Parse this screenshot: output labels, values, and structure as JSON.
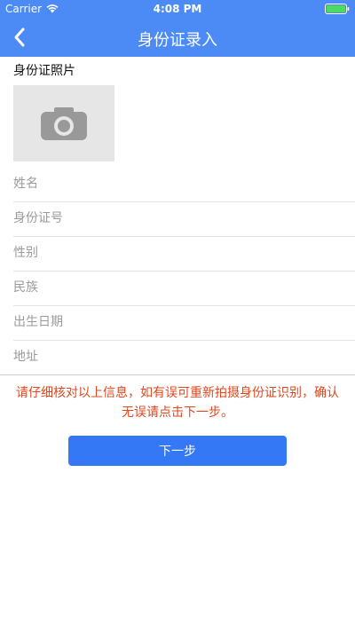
{
  "status_bar": {
    "carrier": "Carrier",
    "time": "4:08 PM",
    "battery_color": "#4cd964"
  },
  "nav": {
    "title": "身份证录入",
    "back_icon": "chevron-left-icon"
  },
  "photo_section": {
    "label": "身份证照片",
    "icon": "camera-icon"
  },
  "fields": [
    {
      "placeholder": "姓名",
      "value": ""
    },
    {
      "placeholder": "身份证号",
      "value": ""
    },
    {
      "placeholder": "性别",
      "value": ""
    },
    {
      "placeholder": "民族",
      "value": ""
    },
    {
      "placeholder": "出生日期",
      "value": ""
    },
    {
      "placeholder": "地址",
      "value": ""
    }
  ],
  "notice": "请仔细核对以上信息，如有误可重新拍摄身份证识别，确认无误请点击下一步。",
  "next_button": "下一步",
  "colors": {
    "nav_blue": "#4c8bf5",
    "button_blue": "#3478f6",
    "notice_red": "#e0471f"
  }
}
